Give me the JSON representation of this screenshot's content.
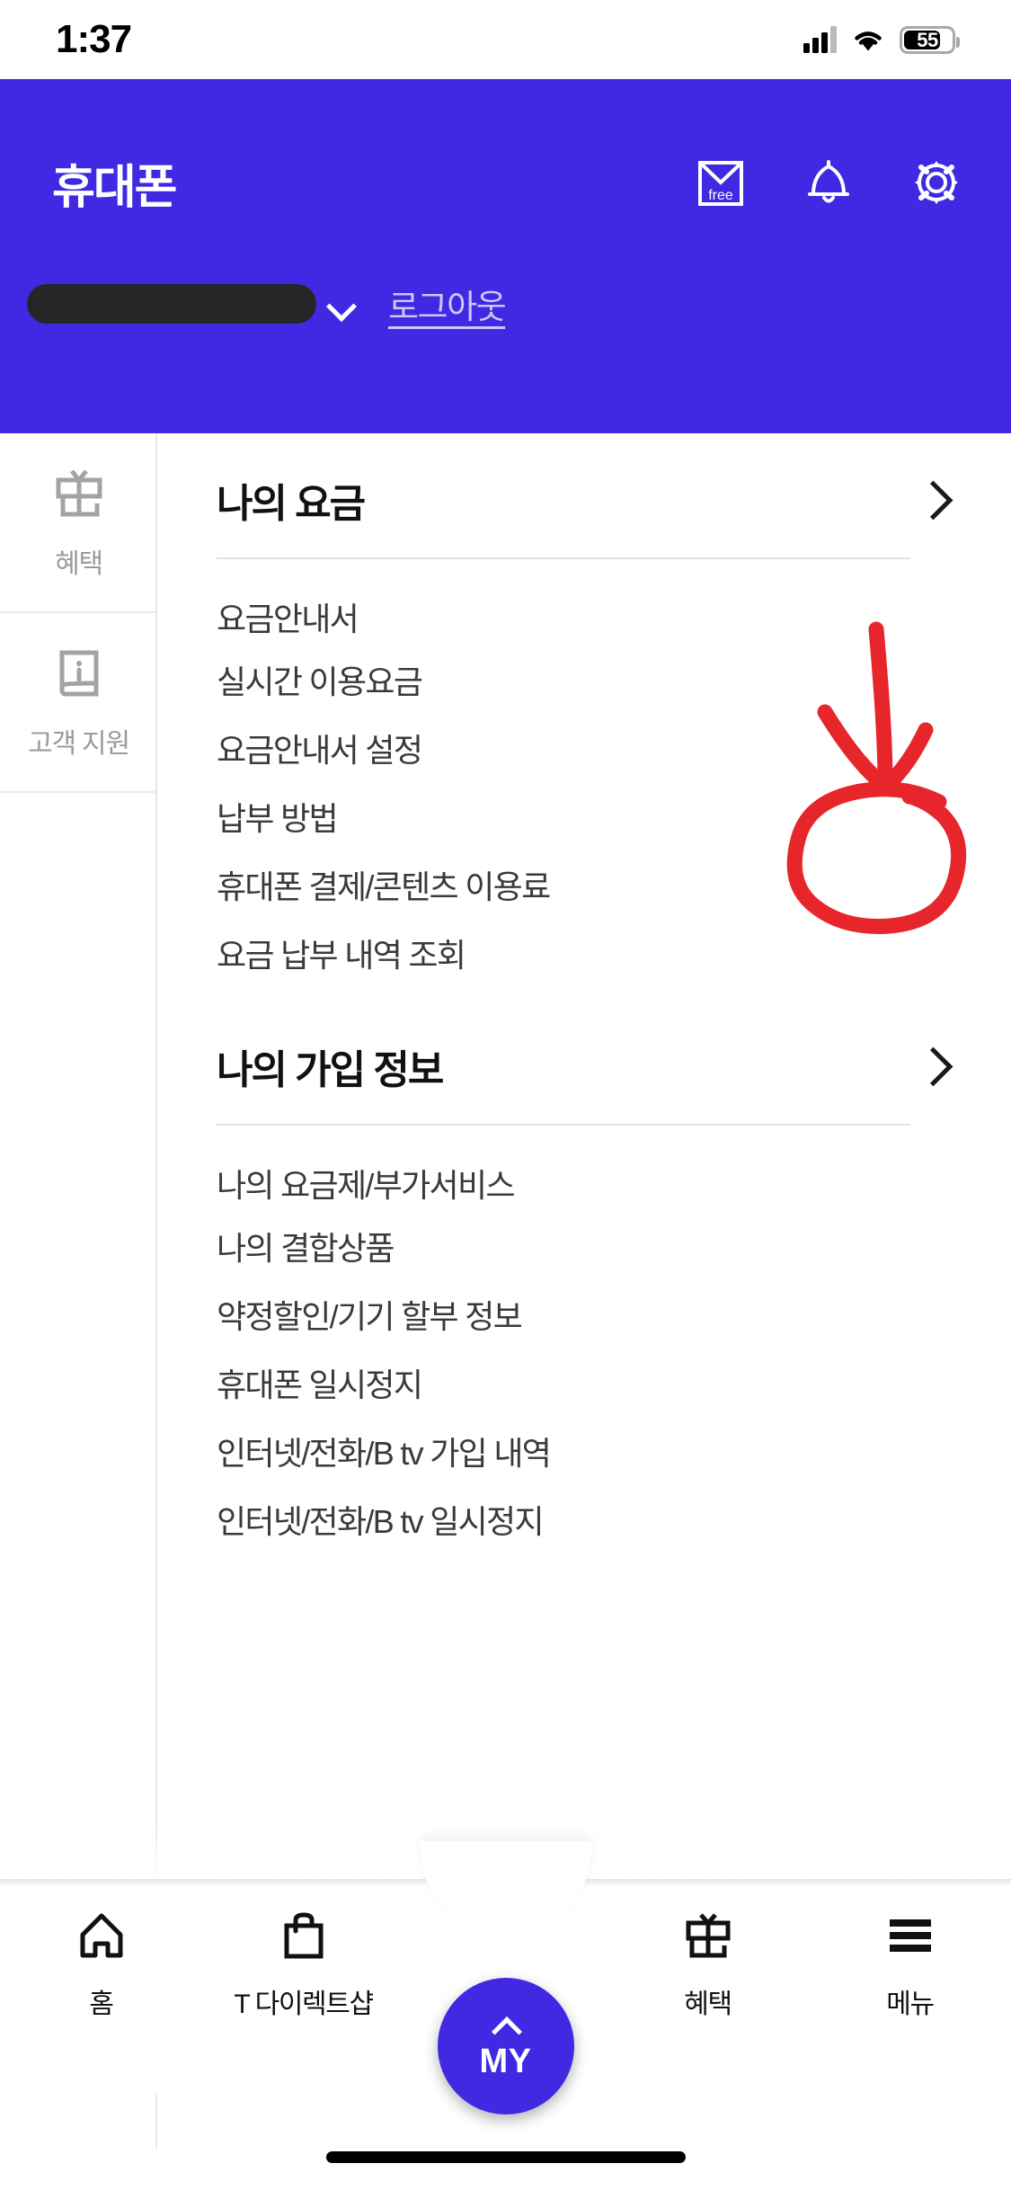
{
  "status_bar": {
    "time": "1:37",
    "battery_level": "55",
    "icons": [
      "cellular-signal-icon",
      "wifi-icon",
      "battery-icon"
    ]
  },
  "header": {
    "title": "휴대폰",
    "background_color": "#4128E3",
    "icons": [
      {
        "name": "free-mail-icon",
        "label": "free"
      },
      {
        "name": "bell-icon",
        "label": ""
      },
      {
        "name": "gear-icon",
        "label": ""
      }
    ],
    "account_selector": {
      "value_redacted": true,
      "chevron": "chevron-down-icon"
    },
    "logout_label": "로그아웃"
  },
  "side_rail": {
    "items": [
      {
        "icon": "gift-icon",
        "label": "혜택"
      },
      {
        "icon": "book-info-icon",
        "label": "고객 지원"
      }
    ]
  },
  "main": {
    "sections": [
      {
        "title": "나의 요금",
        "chevron": "chevron-right-icon",
        "items": [
          "요금안내서",
          "실시간 이용요금",
          "요금안내서 설정",
          "납부 방법",
          "휴대폰 결제/콘텐츠 이용료",
          "요금 납부 내역 조회"
        ]
      },
      {
        "title": "나의 가입 정보",
        "chevron": "chevron-right-icon",
        "items": [
          "나의 요금제/부가서비스",
          "나의 결합상품",
          "약정할인/기기 할부 정보",
          "휴대폰 일시정지",
          "인터넷/전화/B tv 가입 내역",
          "인터넷/전화/B tv 일시정지"
        ]
      }
    ]
  },
  "annotation": {
    "type": "handdrawn",
    "color": "#E7262C",
    "shapes": [
      "arrow-down",
      "circle-highlight"
    ],
    "targets": "나의 가입 정보 chevron-right-icon"
  },
  "bottom_nav": {
    "items": [
      {
        "icon": "home-icon",
        "label": "홈"
      },
      {
        "icon": "shopping-bag-icon",
        "label": "T 다이렉트샵"
      },
      {
        "icon": "gift-icon",
        "label": "혜택"
      },
      {
        "icon": "hamburger-menu-icon",
        "label": "메뉴"
      }
    ],
    "fab": {
      "label": "MY",
      "caret": "chevron-up-icon",
      "color": "#4128E3"
    }
  }
}
